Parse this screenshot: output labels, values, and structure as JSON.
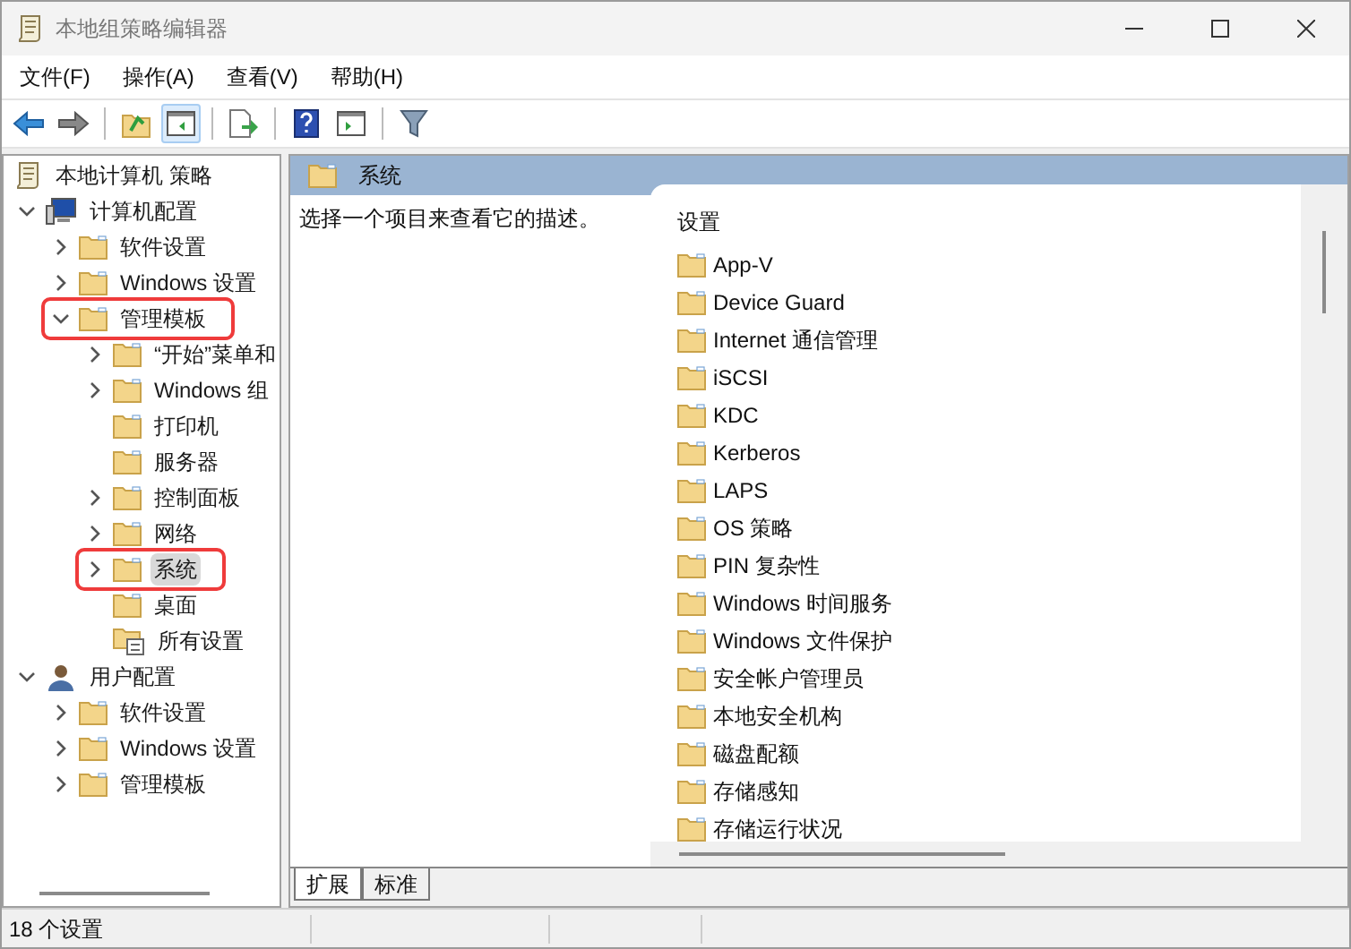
{
  "window": {
    "title": "本地组策略编辑器"
  },
  "menu": [
    "文件(F)",
    "操作(A)",
    "查看(V)",
    "帮助(H)"
  ],
  "toolbar": [
    {
      "kind": "back",
      "pressed": false
    },
    {
      "kind": "forward",
      "pressed": false
    },
    {
      "kind": "up",
      "pressed": false
    },
    {
      "kind": "panel",
      "pressed": true
    },
    {
      "kind": "export",
      "pressed": false
    },
    {
      "kind": "help",
      "pressed": false
    },
    {
      "kind": "panel2",
      "pressed": false
    },
    {
      "kind": "filter",
      "pressed": false
    }
  ],
  "tree": [
    {
      "label": "本地计算机 策略",
      "kind": "scroll",
      "selected": false,
      "highlighted": false,
      "children": [
        {
          "label": "计算机配置",
          "kind": "computer",
          "expanded": true,
          "selected": false,
          "highlighted": false,
          "children": [
            {
              "label": "软件设置",
              "kind": "folder",
              "expanded": false,
              "selected": false,
              "highlighted": false
            },
            {
              "label": "Windows 设置",
              "kind": "folder",
              "expanded": false,
              "selected": false,
              "highlighted": false
            },
            {
              "label": "管理模板",
              "kind": "folder",
              "expanded": true,
              "selected": false,
              "highlighted": true,
              "children": [
                {
                  "label": "“开始”菜单和",
                  "kind": "folder",
                  "expanded": false,
                  "selected": false,
                  "highlighted": false
                },
                {
                  "label": "Windows 组",
                  "kind": "folder",
                  "expanded": false,
                  "selected": false,
                  "highlighted": false
                },
                {
                  "label": "打印机",
                  "kind": "folder",
                  "selected": false,
                  "highlighted": false
                },
                {
                  "label": "服务器",
                  "kind": "folder",
                  "selected": false,
                  "highlighted": false
                },
                {
                  "label": "控制面板",
                  "kind": "folder",
                  "expanded": false,
                  "selected": false,
                  "highlighted": false
                },
                {
                  "label": "网络",
                  "kind": "folder",
                  "expanded": false,
                  "selected": false,
                  "highlighted": false
                },
                {
                  "label": "系统",
                  "kind": "folder",
                  "expanded": false,
                  "selected": true,
                  "highlighted": true
                },
                {
                  "label": "桌面",
                  "kind": "folder",
                  "selected": false,
                  "highlighted": false
                },
                {
                  "label": "所有设置",
                  "kind": "settings",
                  "selected": false,
                  "highlighted": false
                }
              ]
            }
          ]
        },
        {
          "label": "用户配置",
          "kind": "user",
          "expanded": true,
          "selected": false,
          "highlighted": false,
          "children": [
            {
              "label": "软件设置",
              "kind": "folder",
              "expanded": false,
              "selected": false,
              "highlighted": false
            },
            {
              "label": "Windows 设置",
              "kind": "folder",
              "expanded": false,
              "selected": false,
              "highlighted": false
            },
            {
              "label": "管理模板",
              "kind": "folder",
              "expanded": false,
              "selected": false,
              "highlighted": false
            }
          ]
        }
      ]
    }
  ],
  "detail": {
    "title": "系统",
    "description": "选择一个项目来查看它的描述。",
    "column": "设置",
    "items": [
      "App-V",
      "Device Guard",
      "Internet 通信管理",
      "iSCSI",
      "KDC",
      "Kerberos",
      "LAPS",
      "OS 策略",
      "PIN 复杂性",
      "Windows 时间服务",
      "Windows 文件保护",
      "安全帐户管理员",
      "本地安全机构",
      "磁盘配额",
      "存储感知",
      "存储运行状况"
    ]
  },
  "tabs": [
    {
      "label": "扩展",
      "selected": true
    },
    {
      "label": "标准",
      "selected": false
    }
  ],
  "status_bar": "18 个设置"
}
